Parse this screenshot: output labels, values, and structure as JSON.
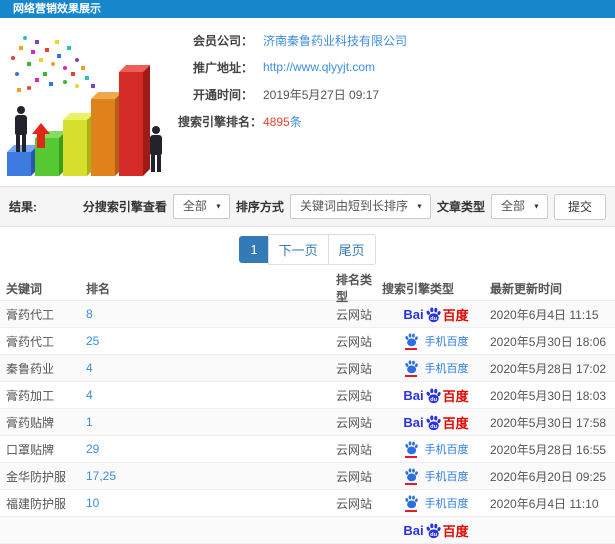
{
  "title": "网络营销效果展示",
  "info": {
    "rows": [
      {
        "label": "会员公司：",
        "value": "济南秦鲁药业科技有限公司"
      },
      {
        "label": "推广地址：",
        "value": "http://www.qlyyjt.com"
      },
      {
        "label": "开通时间：",
        "value": "2019年5月27日 09:17"
      },
      {
        "label": "搜索引擎排名：",
        "value": "4895",
        "unit": "条"
      }
    ]
  },
  "filters": {
    "result_label": "结果:",
    "engine_view_label": "分搜索引擎查看",
    "engine_view_value": "全部",
    "sort_label": "排序方式",
    "sort_value": "关键词由短到长排序",
    "article_type_label": "文章类型",
    "article_type_value": "全部",
    "submit_label": "提交"
  },
  "pagination": {
    "current": "1",
    "next_label": "下一页",
    "last_label": "尾页"
  },
  "table": {
    "headers": [
      "关键词",
      "排名",
      "排名类型",
      "搜索引擎类型",
      "最新更新时间"
    ],
    "engine_logos": {
      "baidu": {
        "prefix": "Bai",
        "suffix": "百度"
      },
      "mobile-baidu": {
        "text": "手机百度"
      }
    },
    "rows": [
      {
        "keyword": "膏药代工",
        "rank": "8",
        "rank_type": "云网站",
        "engine": "baidu",
        "updated": "2020年6月4日 11:15"
      },
      {
        "keyword": "膏药代工",
        "rank": "25",
        "rank_type": "云网站",
        "engine": "mobile-baidu",
        "updated": "2020年5月30日 18:06"
      },
      {
        "keyword": "秦鲁药业",
        "rank": "4",
        "rank_type": "云网站",
        "engine": "mobile-baidu",
        "updated": "2020年5月28日 17:02"
      },
      {
        "keyword": "膏药加工",
        "rank": "4",
        "rank_type": "云网站",
        "engine": "baidu",
        "updated": "2020年5月30日 18:03"
      },
      {
        "keyword": "膏药贴牌",
        "rank": "1",
        "rank_type": "云网站",
        "engine": "baidu",
        "updated": "2020年5月30日 17:58"
      },
      {
        "keyword": "口罩贴牌",
        "rank": "29",
        "rank_type": "云网站",
        "engine": "mobile-baidu",
        "updated": "2020年5月28日 16:55"
      },
      {
        "keyword": "金华防护服",
        "rank": "17,25",
        "rank_type": "云网站",
        "engine": "mobile-baidu",
        "updated": "2020年6月20日 09:25"
      },
      {
        "keyword": "福建防护服",
        "rank": "10",
        "rank_type": "云网站",
        "engine": "mobile-baidu",
        "updated": "2020年6月4日 11:10"
      },
      {
        "keyword": "",
        "rank": "",
        "rank_type": "",
        "engine": "baidu",
        "updated": ""
      }
    ]
  },
  "colors": {
    "topbar_blue": "#1787cb",
    "link_blue": "#3c8edc",
    "rank_count_red": "#e8442e",
    "active_page_blue": "#337ab7",
    "baidu_blue": "#2932e1",
    "baidu_red": "#e10600",
    "mobile_baidu_blue": "#2b7ce0"
  }
}
